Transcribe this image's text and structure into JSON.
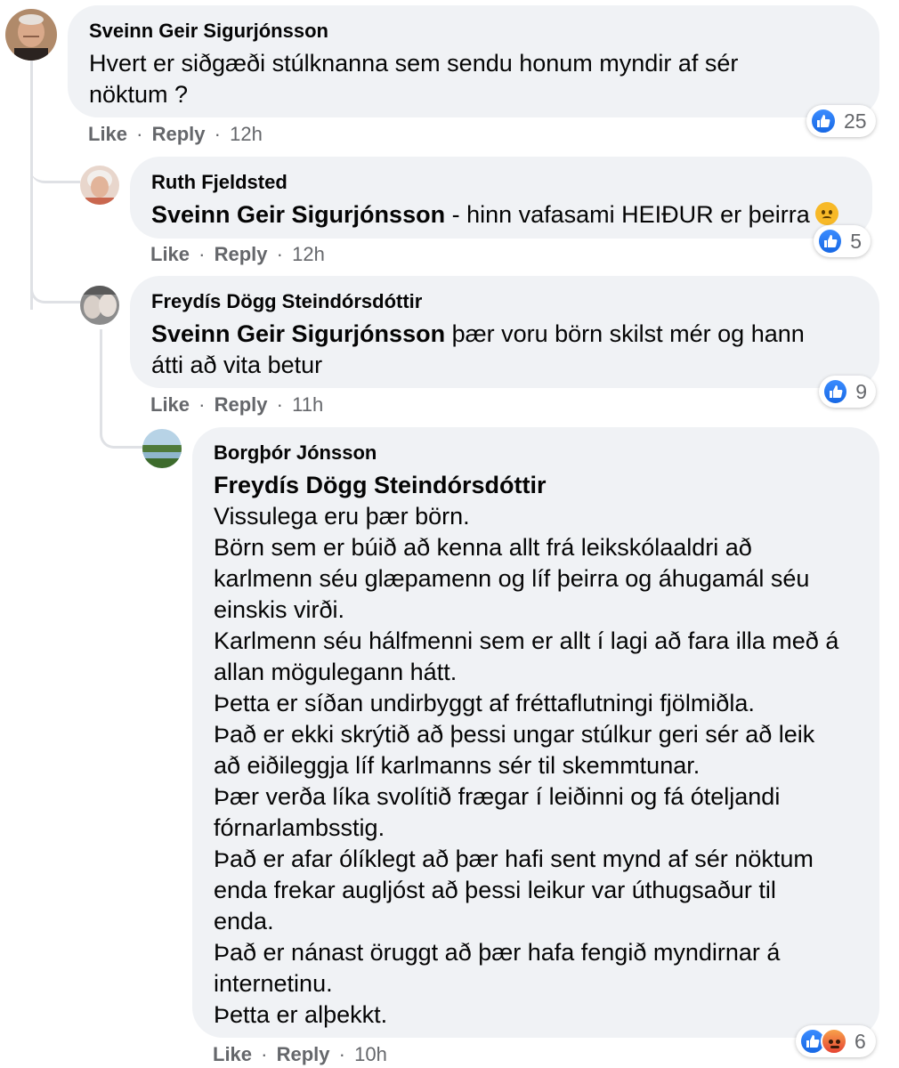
{
  "colors": {
    "bubble_bg": "#f0f2f5",
    "like_blue": "#1877f2",
    "meta_gray": "#65676b",
    "thread_line": "#dfe1e5"
  },
  "actions": {
    "like": "Like",
    "reply": "Reply",
    "separator": "·"
  },
  "comments": [
    {
      "author": "Sveinn Geir Sigurjónsson",
      "lines": [
        "Hvert er siðgæði stúlknanna sem sendu honum myndir af sér",
        "nöktum ?"
      ],
      "time": "12h",
      "reaction_count": "25",
      "avatar_icon": "profile-photo-older-man"
    },
    {
      "author": "Ruth Fjeldsted",
      "mention": "Sveinn Geir Sigurjónsson",
      "text": " - hinn vafasami HEIÐUR er þeirra",
      "emoji": "sad-face-icon",
      "time": "12h",
      "reaction_count": "5",
      "avatar_icon": "profile-photo-older-woman"
    },
    {
      "author": "Freydís Dögg Steindórsdóttir",
      "mention": "Sveinn Geir Sigurjónsson",
      "lines": [
        " þær voru börn skilst mér og hann",
        "átti að vita betur"
      ],
      "time": "11h",
      "reaction_count": "9",
      "avatar_icon": "profile-photo-two-women"
    },
    {
      "author": "Borgþór Jónsson",
      "mention": "Freydís Dögg Steindórsdóttir",
      "lines": [
        "Vissulega eru þær börn.",
        "Börn sem er búið að kenna allt frá leikskólaaldri að",
        "karlmenn séu glæpamenn og líf þeirra og áhugamál séu",
        "einskis virði.",
        "Karlmenn séu hálfmenni sem er allt í lagi að fara illa með á",
        "allan mögulegann hátt.",
        "Þetta er síðan undirbyggt af fréttaflutningi fjölmiðla.",
        "Það er ekki skrýtið að þessi ungar stúlkur geri sér að leik",
        "að eiðileggja líf karlmanns sér til skemmtunar.",
        "Þær verða líka svolítið frægar í leiðinni og fá óteljandi",
        "fórnarlambsstig.",
        "Það er afar ólíklegt að þær hafi sent mynd af sér nöktum",
        "enda frekar augljóst að þessi leikur var úthugsaður til",
        "enda.",
        "Það er nánast öruggt að þær hafa fengið myndirnar á",
        "internetinu.",
        "Þetta er alþekkt."
      ],
      "time": "10h",
      "reaction_count": "6",
      "avatar_icon": "profile-photo-lake-landscape"
    }
  ]
}
